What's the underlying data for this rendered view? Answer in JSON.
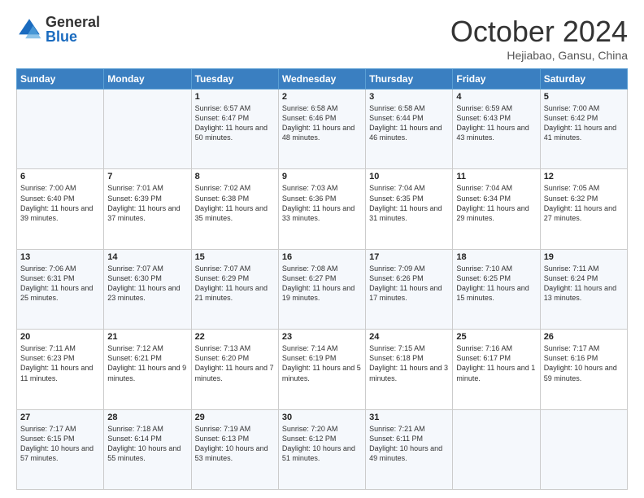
{
  "logo": {
    "general": "General",
    "blue": "Blue"
  },
  "title": "October 2024",
  "subtitle": "Hejiabao, Gansu, China",
  "days_of_week": [
    "Sunday",
    "Monday",
    "Tuesday",
    "Wednesday",
    "Thursday",
    "Friday",
    "Saturday"
  ],
  "weeks": [
    [
      {
        "day": "",
        "text": ""
      },
      {
        "day": "",
        "text": ""
      },
      {
        "day": "1",
        "text": "Sunrise: 6:57 AM\nSunset: 6:47 PM\nDaylight: 11 hours and 50 minutes."
      },
      {
        "day": "2",
        "text": "Sunrise: 6:58 AM\nSunset: 6:46 PM\nDaylight: 11 hours and 48 minutes."
      },
      {
        "day": "3",
        "text": "Sunrise: 6:58 AM\nSunset: 6:44 PM\nDaylight: 11 hours and 46 minutes."
      },
      {
        "day": "4",
        "text": "Sunrise: 6:59 AM\nSunset: 6:43 PM\nDaylight: 11 hours and 43 minutes."
      },
      {
        "day": "5",
        "text": "Sunrise: 7:00 AM\nSunset: 6:42 PM\nDaylight: 11 hours and 41 minutes."
      }
    ],
    [
      {
        "day": "6",
        "text": "Sunrise: 7:00 AM\nSunset: 6:40 PM\nDaylight: 11 hours and 39 minutes."
      },
      {
        "day": "7",
        "text": "Sunrise: 7:01 AM\nSunset: 6:39 PM\nDaylight: 11 hours and 37 minutes."
      },
      {
        "day": "8",
        "text": "Sunrise: 7:02 AM\nSunset: 6:38 PM\nDaylight: 11 hours and 35 minutes."
      },
      {
        "day": "9",
        "text": "Sunrise: 7:03 AM\nSunset: 6:36 PM\nDaylight: 11 hours and 33 minutes."
      },
      {
        "day": "10",
        "text": "Sunrise: 7:04 AM\nSunset: 6:35 PM\nDaylight: 11 hours and 31 minutes."
      },
      {
        "day": "11",
        "text": "Sunrise: 7:04 AM\nSunset: 6:34 PM\nDaylight: 11 hours and 29 minutes."
      },
      {
        "day": "12",
        "text": "Sunrise: 7:05 AM\nSunset: 6:32 PM\nDaylight: 11 hours and 27 minutes."
      }
    ],
    [
      {
        "day": "13",
        "text": "Sunrise: 7:06 AM\nSunset: 6:31 PM\nDaylight: 11 hours and 25 minutes."
      },
      {
        "day": "14",
        "text": "Sunrise: 7:07 AM\nSunset: 6:30 PM\nDaylight: 11 hours and 23 minutes."
      },
      {
        "day": "15",
        "text": "Sunrise: 7:07 AM\nSunset: 6:29 PM\nDaylight: 11 hours and 21 minutes."
      },
      {
        "day": "16",
        "text": "Sunrise: 7:08 AM\nSunset: 6:27 PM\nDaylight: 11 hours and 19 minutes."
      },
      {
        "day": "17",
        "text": "Sunrise: 7:09 AM\nSunset: 6:26 PM\nDaylight: 11 hours and 17 minutes."
      },
      {
        "day": "18",
        "text": "Sunrise: 7:10 AM\nSunset: 6:25 PM\nDaylight: 11 hours and 15 minutes."
      },
      {
        "day": "19",
        "text": "Sunrise: 7:11 AM\nSunset: 6:24 PM\nDaylight: 11 hours and 13 minutes."
      }
    ],
    [
      {
        "day": "20",
        "text": "Sunrise: 7:11 AM\nSunset: 6:23 PM\nDaylight: 11 hours and 11 minutes."
      },
      {
        "day": "21",
        "text": "Sunrise: 7:12 AM\nSunset: 6:21 PM\nDaylight: 11 hours and 9 minutes."
      },
      {
        "day": "22",
        "text": "Sunrise: 7:13 AM\nSunset: 6:20 PM\nDaylight: 11 hours and 7 minutes."
      },
      {
        "day": "23",
        "text": "Sunrise: 7:14 AM\nSunset: 6:19 PM\nDaylight: 11 hours and 5 minutes."
      },
      {
        "day": "24",
        "text": "Sunrise: 7:15 AM\nSunset: 6:18 PM\nDaylight: 11 hours and 3 minutes."
      },
      {
        "day": "25",
        "text": "Sunrise: 7:16 AM\nSunset: 6:17 PM\nDaylight: 11 hours and 1 minute."
      },
      {
        "day": "26",
        "text": "Sunrise: 7:17 AM\nSunset: 6:16 PM\nDaylight: 10 hours and 59 minutes."
      }
    ],
    [
      {
        "day": "27",
        "text": "Sunrise: 7:17 AM\nSunset: 6:15 PM\nDaylight: 10 hours and 57 minutes."
      },
      {
        "day": "28",
        "text": "Sunrise: 7:18 AM\nSunset: 6:14 PM\nDaylight: 10 hours and 55 minutes."
      },
      {
        "day": "29",
        "text": "Sunrise: 7:19 AM\nSunset: 6:13 PM\nDaylight: 10 hours and 53 minutes."
      },
      {
        "day": "30",
        "text": "Sunrise: 7:20 AM\nSunset: 6:12 PM\nDaylight: 10 hours and 51 minutes."
      },
      {
        "day": "31",
        "text": "Sunrise: 7:21 AM\nSunset: 6:11 PM\nDaylight: 10 hours and 49 minutes."
      },
      {
        "day": "",
        "text": ""
      },
      {
        "day": "",
        "text": ""
      }
    ]
  ]
}
